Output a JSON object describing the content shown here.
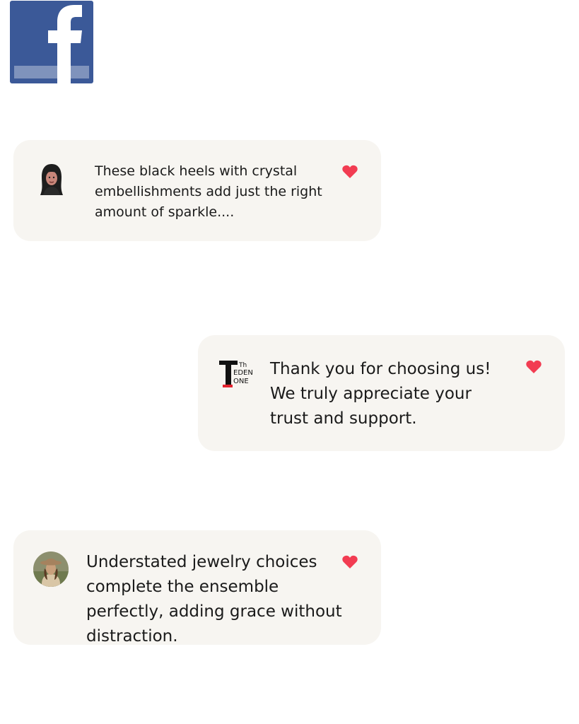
{
  "header": {
    "logo_icon": "facebook-icon",
    "logo_color": "#3b5998"
  },
  "comments": [
    {
      "avatar": "hijab-woman-avatar",
      "text": "These black heels with crystal embellishments add just the right amount of sparkle....",
      "icon": "heart-icon"
    },
    {
      "avatar": "the-eden-zone-logo",
      "avatar_text": [
        "Th",
        "EDEN",
        "ONE"
      ],
      "text": "Thank you for choosing us! We truly appreciate your trust and support.",
      "icon": "heart-icon"
    },
    {
      "avatar": "woman-with-hat-avatar",
      "text": "Understated jewelry choices complete the ensemble perfectly, adding grace without distraction.",
      "icon": "heart-icon"
    }
  ],
  "colors": {
    "heart": "#f23c52",
    "bubble": "#f7f5f1"
  }
}
